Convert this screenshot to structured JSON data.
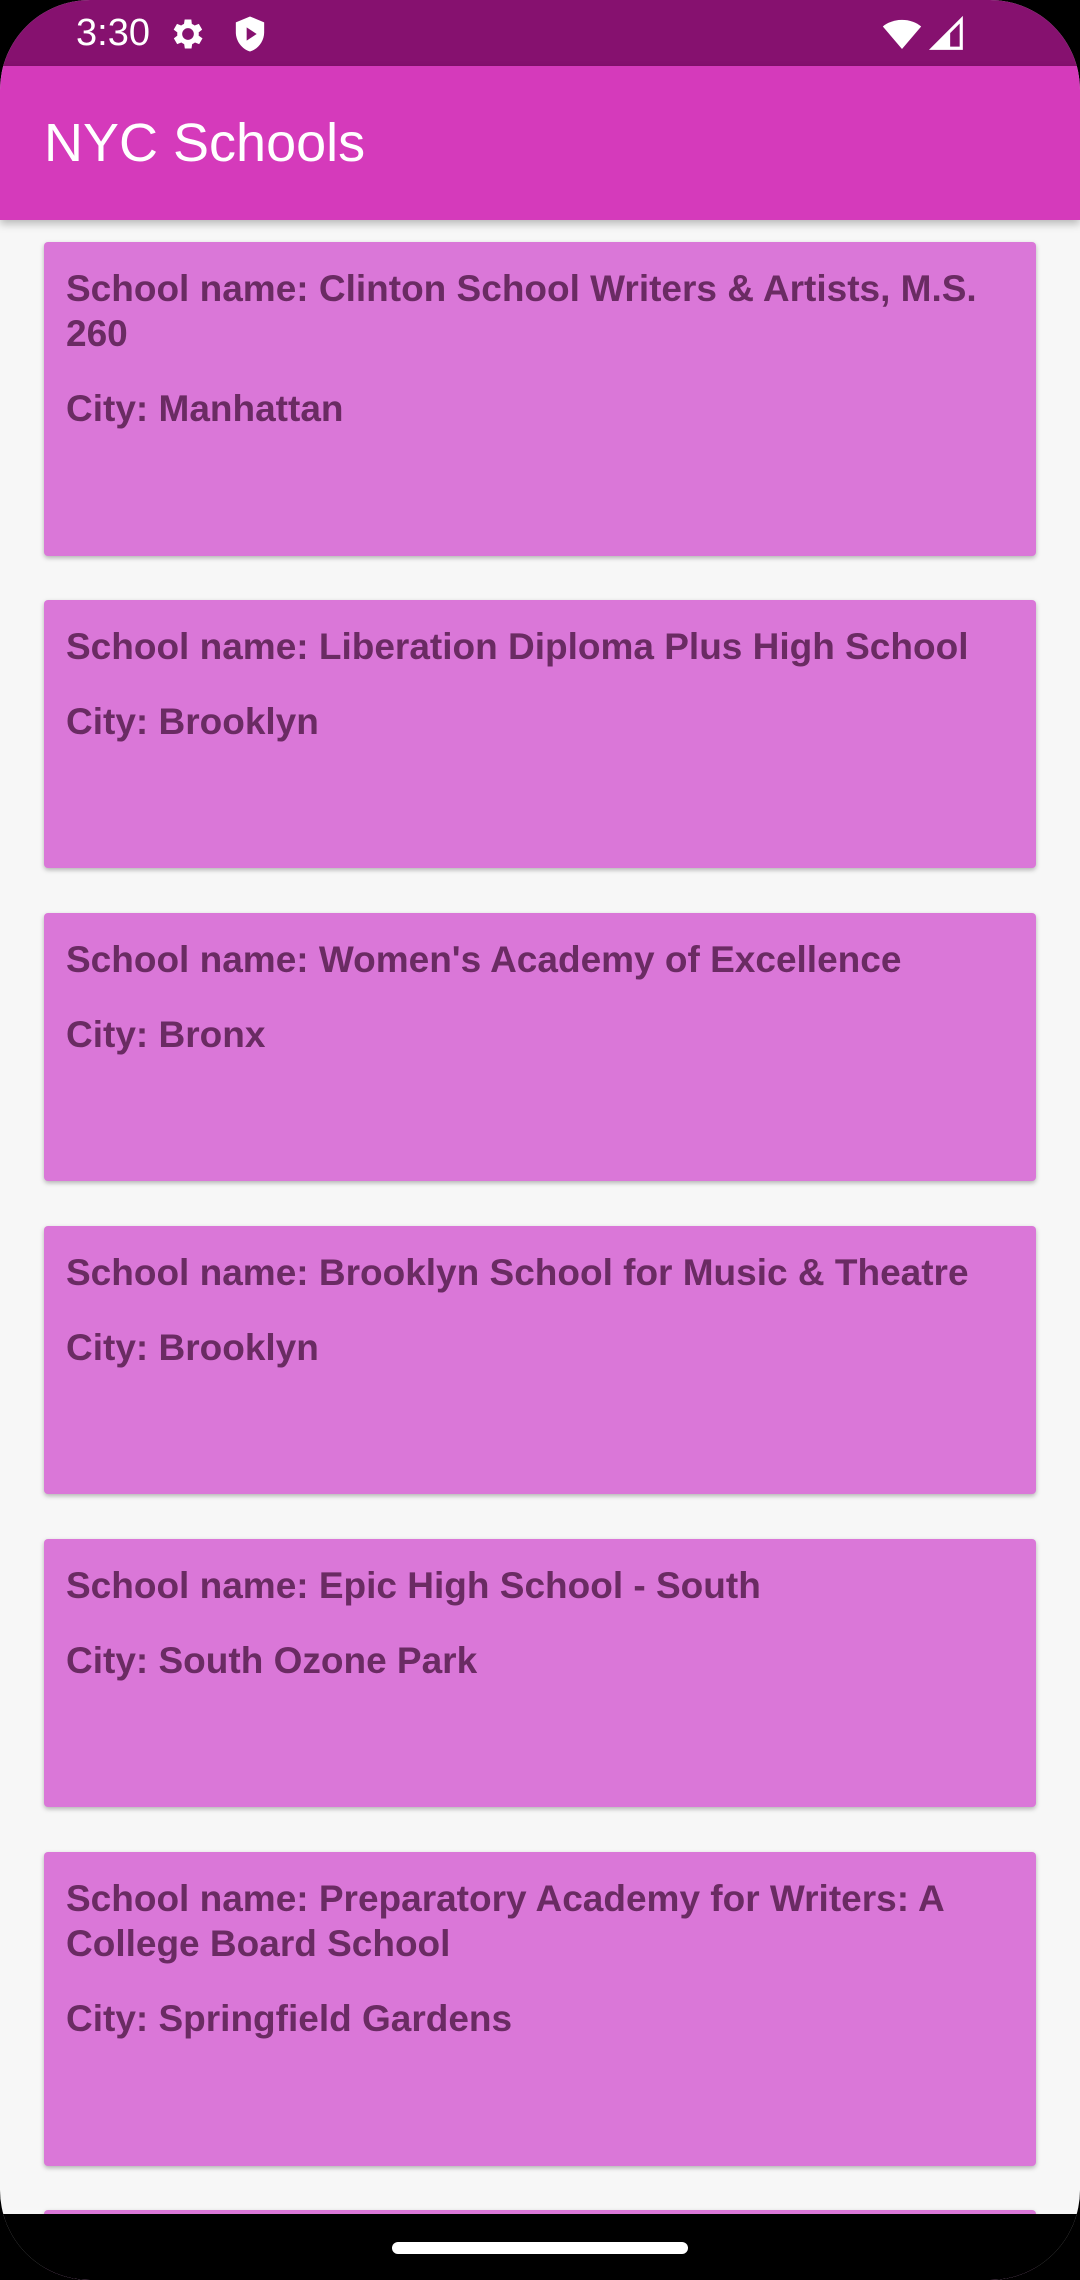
{
  "status_bar": {
    "time": "3:30",
    "icons": [
      "gear-icon",
      "shield-play-icon",
      "wifi-icon",
      "signal-icon"
    ]
  },
  "app_bar": {
    "title": "NYC Schools"
  },
  "colors": {
    "status_bar": "#86116f",
    "app_bar": "#d53abb",
    "card": "#da77d8",
    "card_text": "#6a2b63",
    "background": "#f7f7f7"
  },
  "schools": [
    {
      "name": "School name: Clinton School Writers & Artists, M.S. 260",
      "city": "City: Manhattan"
    },
    {
      "name": "School name: Liberation Diploma Plus High School",
      "city": "City: Brooklyn"
    },
    {
      "name": "School name: Women's Academy of Excellence",
      "city": "City: Bronx"
    },
    {
      "name": "School name: Brooklyn School for Music & Theatre",
      "city": "City: Brooklyn"
    },
    {
      "name": "School name: Epic High School - South",
      "city": "City: South Ozone Park"
    },
    {
      "name": "School name: Preparatory Academy for Writers: A College Board School",
      "city": "City: Springfield Gardens"
    }
  ]
}
